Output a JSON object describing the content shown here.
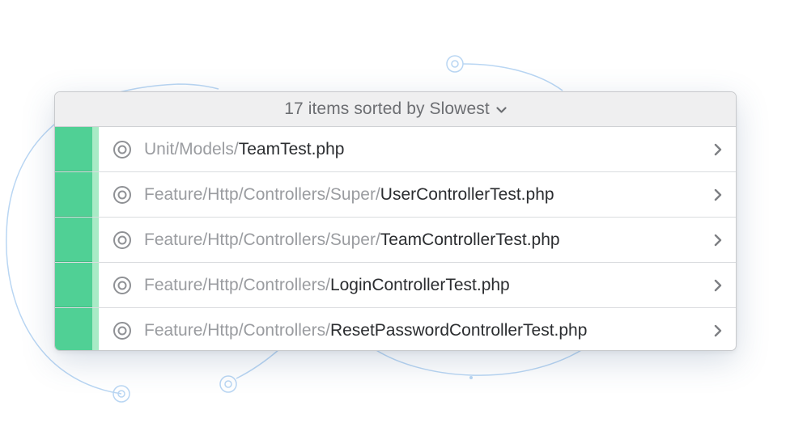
{
  "header": {
    "label": "17 items sorted by Slowest",
    "dropdown_icon": "chevron-down-icon"
  },
  "colors": {
    "pass": "#50d095",
    "pass_edge": "#a8ebc6",
    "path_dir": "#9a9ca0",
    "path_file": "#2b2d30",
    "decor_line": "#b9d6f3"
  },
  "items": [
    {
      "dir": "Unit/Models/",
      "file": "TeamTest.php",
      "status": "passed",
      "icon": "target-icon"
    },
    {
      "dir": "Feature/Http/Controllers/Super/",
      "file": "UserControllerTest.php",
      "status": "passed",
      "icon": "target-icon"
    },
    {
      "dir": "Feature/Http/Controllers/Super/",
      "file": "TeamControllerTest.php",
      "status": "passed",
      "icon": "target-icon"
    },
    {
      "dir": "Feature/Http/Controllers/",
      "file": "LoginControllerTest.php",
      "status": "passed",
      "icon": "target-icon"
    },
    {
      "dir": "Feature/Http/Controllers/",
      "file": "ResetPasswordControllerTest.php",
      "status": "passed",
      "icon": "target-icon"
    }
  ]
}
